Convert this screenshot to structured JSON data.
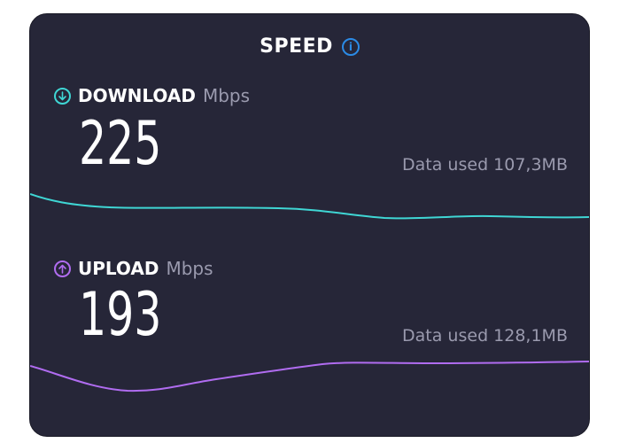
{
  "header": {
    "title": "SPEED",
    "info_icon": "info-icon"
  },
  "download": {
    "label": "DOWNLOAD",
    "unit": "Mbps",
    "value": "225",
    "data_used": "Data used 107,3MB",
    "icon": "arrow-down-circle-icon",
    "color": "#3fd6d4"
  },
  "upload": {
    "label": "UPLOAD",
    "unit": "Mbps",
    "value": "193",
    "data_used": "Data used 128,1MB",
    "icon": "arrow-up-circle-icon",
    "color": "#b06cf0"
  },
  "colors": {
    "card_background": "#262638",
    "info_accent": "#2b8be6"
  }
}
